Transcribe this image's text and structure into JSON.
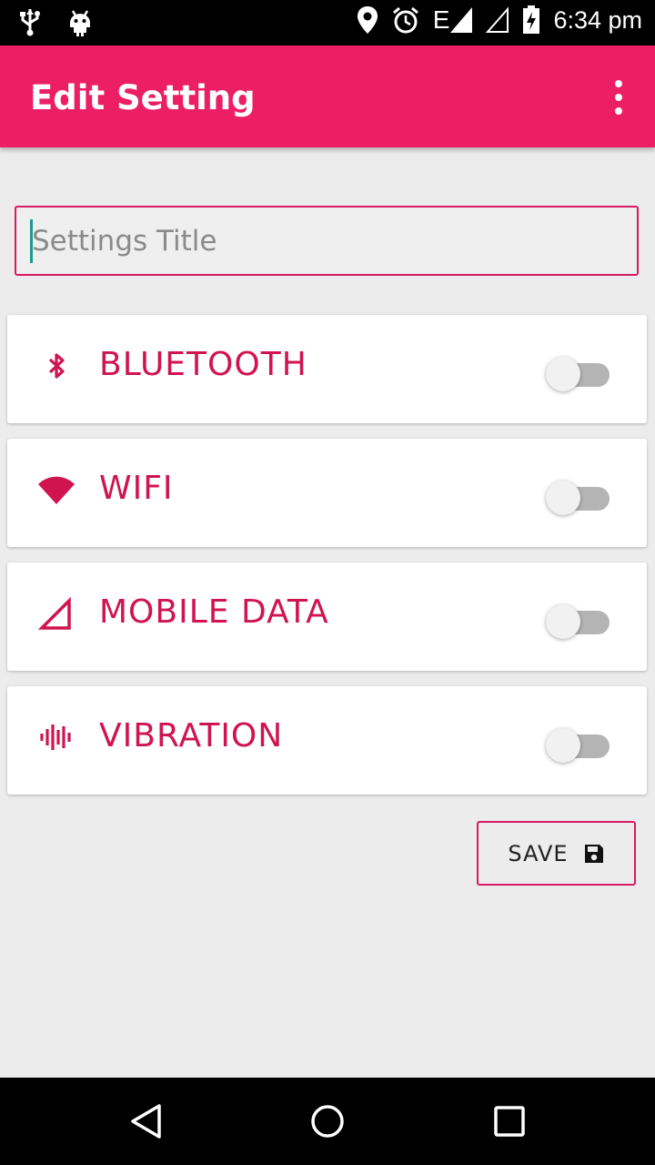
{
  "status_bar": {
    "time": "6:34 pm",
    "network_type": "E",
    "icons": [
      "usb-icon",
      "android-icon",
      "location-icon",
      "alarm-icon",
      "signal-icon",
      "signal-empty-icon",
      "battery-charging-icon"
    ]
  },
  "app_bar": {
    "title": "Edit Setting",
    "menu_icon": "overflow-menu-icon"
  },
  "title_input": {
    "placeholder": "Settings Title",
    "value": ""
  },
  "settings": [
    {
      "label": "BLUETOOTH",
      "icon": "bluetooth-icon",
      "enabled": false
    },
    {
      "label": "WIFI",
      "icon": "wifi-icon",
      "enabled": false
    },
    {
      "label": "MOBILE DATA",
      "icon": "mobile-data-icon",
      "enabled": false
    },
    {
      "label": "VIBRATION",
      "icon": "vibration-icon",
      "enabled": false
    }
  ],
  "save_button": {
    "label": "SAVE",
    "icon": "floppy-disk-icon"
  },
  "nav_bar": {
    "buttons": [
      "back-icon",
      "home-icon",
      "recents-icon"
    ]
  },
  "colors": {
    "accent": "#ec1e64",
    "label_color": "#d0144f",
    "background": "#ececec"
  }
}
